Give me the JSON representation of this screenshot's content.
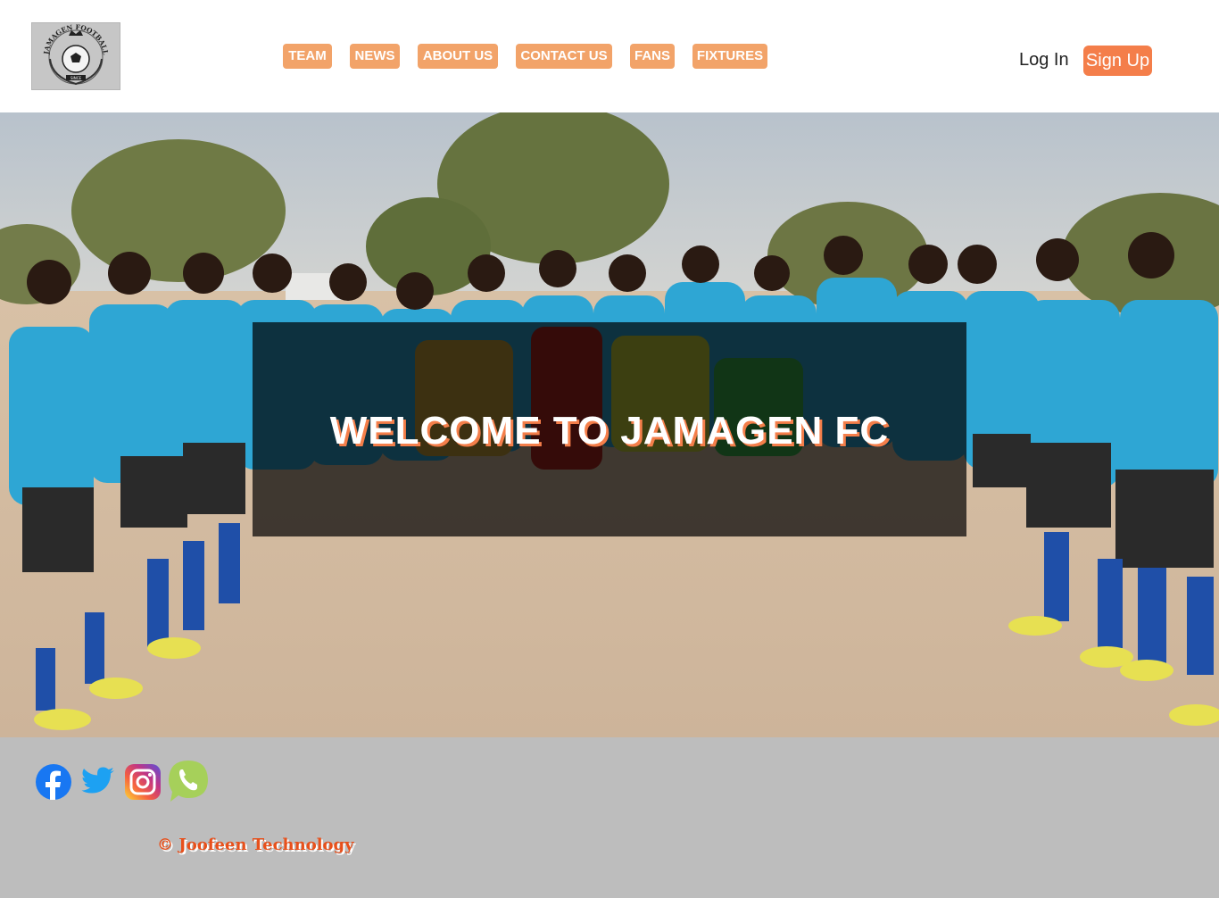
{
  "header": {
    "logo": {
      "lettering": "JAMAGEN FOOTBALL CLUB",
      "since": "SINCE"
    },
    "nav": [
      {
        "label": "TEAM"
      },
      {
        "label": "NEWS"
      },
      {
        "label": "ABOUT US"
      },
      {
        "label": "CONTACT US"
      },
      {
        "label": "FANS"
      },
      {
        "label": "FIXTURES"
      }
    ],
    "login_label": "Log In",
    "signup_label": "Sign Up"
  },
  "hero": {
    "welcome_text": "WELCOME TO JAMAGEN FC"
  },
  "footer": {
    "social_icons": [
      "facebook-icon",
      "twitter-icon",
      "instagram-icon",
      "phone-icon"
    ],
    "copyright": "© Joofeen Technology"
  },
  "colors": {
    "nav_button": "#f2a369",
    "signup_button": "#f47e4a",
    "footer_bg": "#bdbdbd",
    "copyright_text": "#e8501b"
  }
}
